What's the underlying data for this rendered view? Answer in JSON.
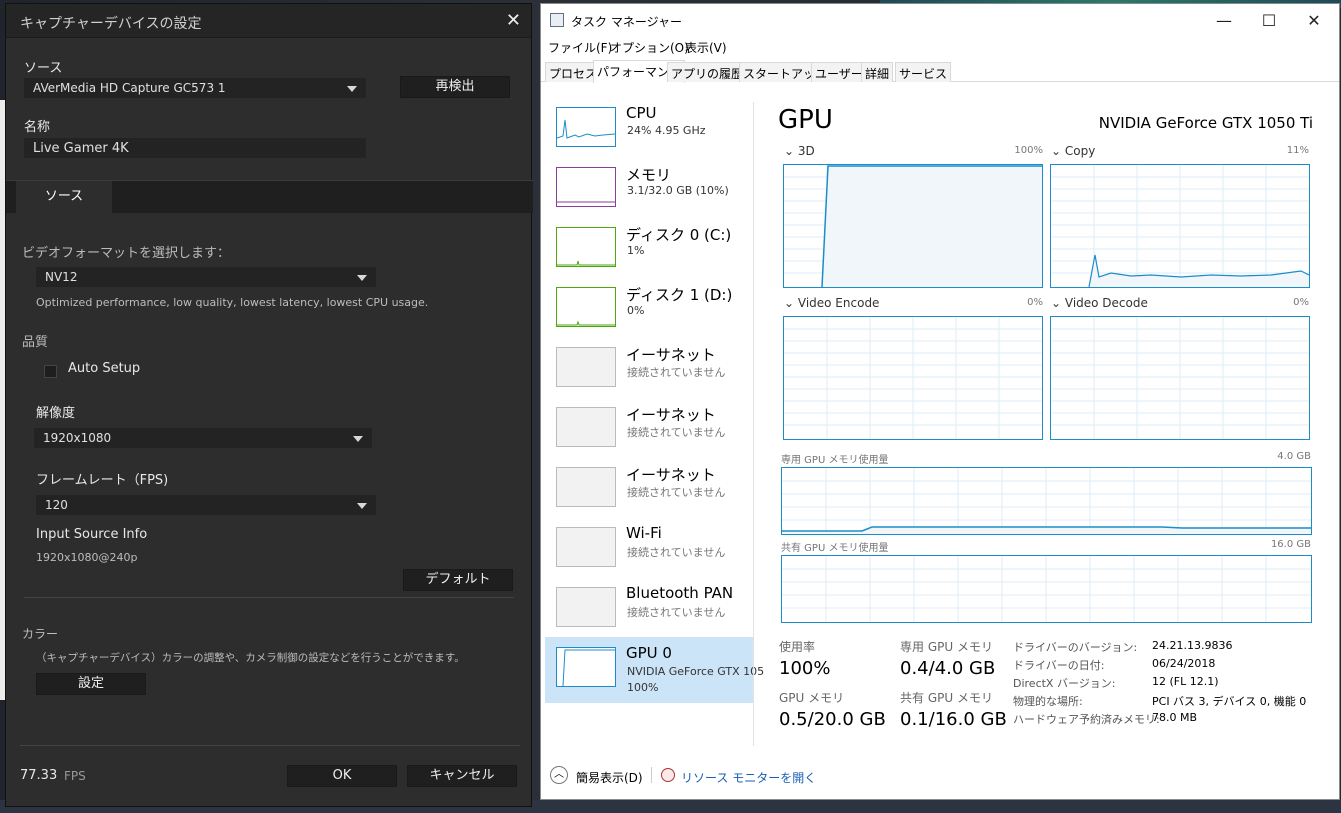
{
  "capture_dialog": {
    "title": "キャプチャーデバイスの設定",
    "source_label": "ソース",
    "source_value": "AVerMedia HD Capture GC573 1",
    "rescan_button": "再検出",
    "name_label": "名称",
    "name_value": "Live Gamer 4K",
    "tab_source": "ソース",
    "video_format_label": "ビデオフォーマットを選択します：",
    "video_format_value": "NV12",
    "video_format_desc": "Optimized performance,  low quality, lowest latency, lowest CPU usage.",
    "quality_label": "品質",
    "auto_setup_label": "Auto Setup",
    "resolution_label": "解像度",
    "resolution_value": "1920x1080",
    "framerate_label": "フレームレート（FPS)",
    "framerate_value": "120",
    "input_source_label": "Input Source Info",
    "input_source_value": "1920x1080@240p",
    "default_button": "デフォルト",
    "color_label": "カラー",
    "color_desc": "（キャプチャーデバイス）カラーの調整や、カメラ制御の設定などを行うことができます。",
    "settings_button": "設定",
    "fps_value": "77.33",
    "fps_unit": "FPS",
    "ok_button": "OK",
    "cancel_button": "キャンセル"
  },
  "task_manager": {
    "title": "タスク マネージャー",
    "menu": [
      "ファイル(F)",
      "オプション(O)",
      "表示(V)"
    ],
    "tabs": [
      "プロセス",
      "パフォーマンス",
      "アプリの履歴",
      "スタートアップ",
      "ユーザー",
      "詳細",
      "サービス"
    ],
    "sidebar": [
      {
        "name": "CPU",
        "detail": "24%  4.95 GHz"
      },
      {
        "name": "メモリ",
        "detail": "3.1/32.0 GB (10%)"
      },
      {
        "name": "ディスク 0 (C:)",
        "detail": "1%"
      },
      {
        "name": "ディスク 1 (D:)",
        "detail": "0%"
      },
      {
        "name": "イーサネット",
        "detail": "接続されていません"
      },
      {
        "name": "イーサネット",
        "detail": "接続されていません"
      },
      {
        "name": "イーサネット",
        "detail": "接続されていません"
      },
      {
        "name": "Wi-Fi",
        "detail": "接続されていません"
      },
      {
        "name": "Bluetooth PAN",
        "detail": "接続されていません"
      },
      {
        "name": "GPU 0",
        "detail": "NVIDIA GeForce GTX 105",
        "detail2": "100%"
      }
    ],
    "heading": "GPU",
    "gpu_name": "NVIDIA GeForce GTX 1050 Ti",
    "engines": [
      {
        "name": "3D",
        "max": "100%"
      },
      {
        "name": "Copy",
        "max": "11%"
      },
      {
        "name": "Video Encode",
        "max": "0%"
      },
      {
        "name": "Video Decode",
        "max": "0%"
      }
    ],
    "dedicated_mem_label": "専用 GPU メモリ使用量",
    "dedicated_mem_max": "4.0 GB",
    "shared_mem_label": "共有 GPU メモリ使用量",
    "shared_mem_max": "16.0 GB",
    "stats": {
      "usage_label": "使用率",
      "usage_value": "100%",
      "dedicated_label": "専用 GPU メモリ",
      "dedicated_value": "0.4/4.0 GB",
      "gpumem_label": "GPU メモリ",
      "gpumem_value": "0.5/20.0 GB",
      "shared_label": "共有 GPU メモリ",
      "shared_value": "0.1/16.0 GB"
    },
    "info": [
      {
        "k": "ドライバーのバージョン:",
        "v": "24.21.13.9836"
      },
      {
        "k": "ドライバーの日付:",
        "v": "06/24/2018"
      },
      {
        "k": "DirectX バージョン:",
        "v": "12 (FL 12.1)"
      },
      {
        "k": "物理的な場所:",
        "v": "PCI バス 3, デバイス 0, 機能 0"
      },
      {
        "k": "ハードウェア予約済みメモリ:",
        "v": "78.0 MB"
      }
    ],
    "fewer_details": "簡易表示(D)",
    "resource_monitor": "リソース モニターを開く",
    "colors": {
      "graph_border": "#1c8dc9",
      "selection": "#cce4f7",
      "memory_border": "#8b3d9a",
      "disk_border": "#4da60c"
    }
  }
}
